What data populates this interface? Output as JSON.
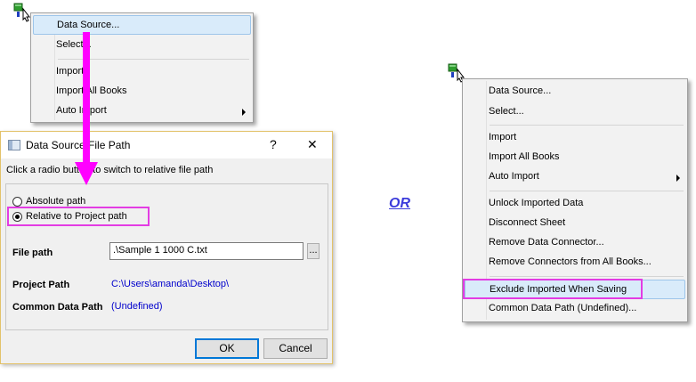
{
  "menu_left": {
    "items": [
      {
        "label": "Data Source..."
      },
      {
        "label": "Select..."
      },
      {
        "label": "Import"
      },
      {
        "label": "Import All Books"
      },
      {
        "label": "Auto Import"
      }
    ]
  },
  "dialog": {
    "title": "Data Source File Path",
    "help_glyph": "?",
    "close_glyph": "✕",
    "instruction": "Click a radio button to switch to relative file path",
    "radio_absolute": "Absolute path",
    "radio_relative": "Relative to Project path",
    "file_path_label": "File path",
    "file_path_value": ".\\Sample 1 1000 C.txt",
    "browse_label": "...",
    "project_path_label": "Project Path",
    "project_path_value": "C:\\Users\\amanda\\Desktop\\",
    "common_path_label": "Common Data Path",
    "common_path_value": "(Undefined)",
    "ok_label": "OK",
    "cancel_label": "Cancel"
  },
  "or_label": "OR",
  "menu_right": {
    "items": [
      {
        "label": "Data Source..."
      },
      {
        "label": "Select..."
      },
      {
        "label": "Import"
      },
      {
        "label": "Import All Books"
      },
      {
        "label": "Auto Import"
      },
      {
        "label": "Unlock Imported Data"
      },
      {
        "label": "Disconnect Sheet"
      },
      {
        "label": "Remove Data Connector..."
      },
      {
        "label": "Remove Connectors from All Books..."
      },
      {
        "label": "Exclude Imported When Saving"
      },
      {
        "label": "Common Data Path (Undefined)..."
      }
    ]
  },
  "colors": {
    "highlight_box": "#e33ce3",
    "arrow": "#ff00ff",
    "or_text": "#3b3bdb",
    "path_text": "#0000cc"
  }
}
